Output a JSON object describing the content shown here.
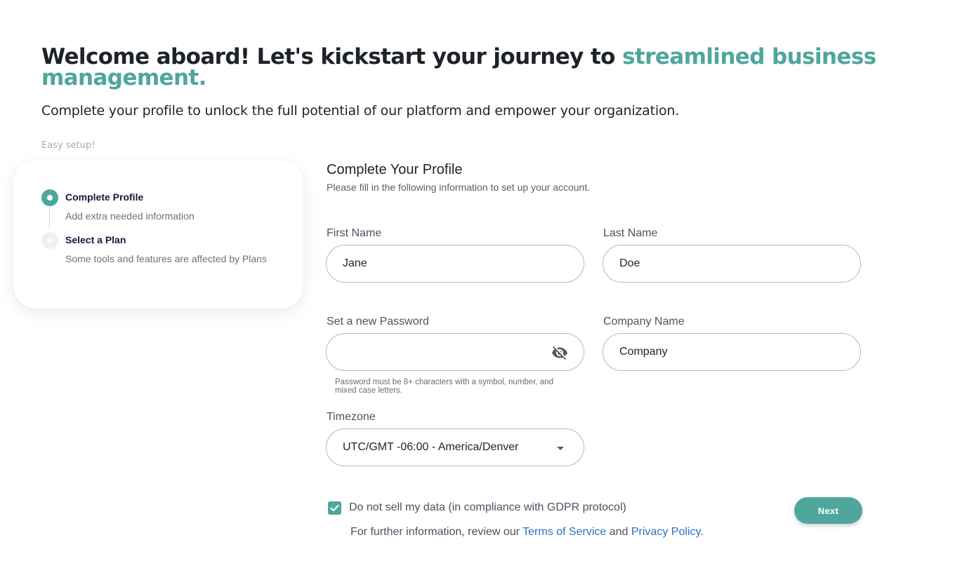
{
  "hero": {
    "title_main": "Welcome aboard! Let's kickstart your journey to ",
    "title_accent": "streamlined business management.",
    "subtitle": "Complete your profile to unlock the full potential of our platform and empower your organization."
  },
  "steps": {
    "caption": "Easy setup!",
    "items": [
      {
        "title": "Complete Profile",
        "description": "Add extra needed information",
        "state": "active"
      },
      {
        "title": "Select a Plan",
        "description": "Some tools and features are affected by Plans",
        "state": "inactive"
      }
    ]
  },
  "form": {
    "title": "Complete Your Profile",
    "subtitle": "Please fill in the following information to set up your account.",
    "first_name": {
      "label": "First Name",
      "value": "Jane"
    },
    "last_name": {
      "label": "Last Name",
      "value": "Doe"
    },
    "password": {
      "label": "Set a new Password",
      "value": "",
      "helper": "Password must be 8+ characters with a symbol, number, and mixed case letters."
    },
    "company": {
      "label": "Company Name",
      "value": "Company"
    },
    "timezone": {
      "label": "Timezone",
      "value": "UTC/GMT -06:00 - America/Denver"
    },
    "gdpr": {
      "label": "Do not sell my data (in compliance with GDPR protocol)",
      "checked": true
    },
    "legal": {
      "prefix": "For further information, review our ",
      "terms": "Terms of Service",
      "and": " and ",
      "privacy": "Privacy Policy",
      "suffix": "."
    },
    "next_label": "Next"
  },
  "colors": {
    "accent": "#4fa69c",
    "link": "#2b72c2",
    "text": "#1e2229"
  },
  "icons": {
    "password_toggle": "eye-off-icon",
    "timezone_dropdown": "caret-down-icon",
    "checkbox": "check-icon"
  }
}
